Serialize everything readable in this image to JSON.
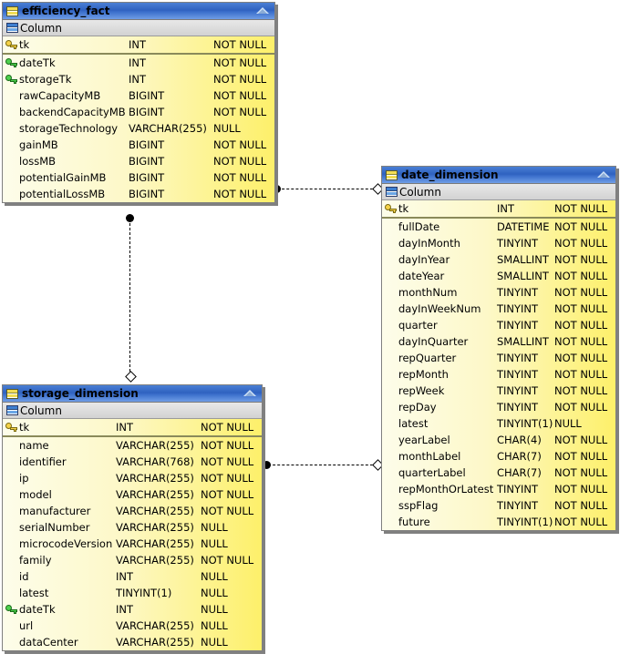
{
  "diagram": {
    "kind": "er-diagram",
    "background": "#ffffff",
    "accent_title_bar": "#3a6ecb",
    "row_fill_left": "#fdfdea",
    "row_fill_right": "#fdf06a",
    "section_label": "Column"
  },
  "entities": [
    {
      "id": "efficiency_fact",
      "title": "efficiency_fact",
      "icon": "table-icon",
      "collapse_icon": "collapse-triangle-icon",
      "section_label": "Column",
      "section_icon": "column-icon",
      "primary_keys": [
        {
          "key": "pk",
          "key_icon": "gold-key-icon",
          "name": "tk",
          "type": "INT",
          "nullable": "NOT NULL"
        }
      ],
      "columns": [
        {
          "key": "fk",
          "key_icon": "green-key-icon",
          "name": "dateTk",
          "type": "INT",
          "nullable": "NOT NULL"
        },
        {
          "key": "fk",
          "key_icon": "green-key-icon",
          "name": "storageTk",
          "type": "INT",
          "nullable": "NOT NULL"
        },
        {
          "key": "",
          "key_icon": "",
          "name": "rawCapacityMB",
          "type": "BIGINT",
          "nullable": "NOT NULL"
        },
        {
          "key": "",
          "key_icon": "",
          "name": "backendCapacityMB",
          "type": "BIGINT",
          "nullable": "NOT NULL"
        },
        {
          "key": "",
          "key_icon": "",
          "name": "storageTechnology",
          "type": "VARCHAR(255)",
          "nullable": "NULL"
        },
        {
          "key": "",
          "key_icon": "",
          "name": "gainMB",
          "type": "BIGINT",
          "nullable": "NOT NULL"
        },
        {
          "key": "",
          "key_icon": "",
          "name": "lossMB",
          "type": "BIGINT",
          "nullable": "NOT NULL"
        },
        {
          "key": "",
          "key_icon": "",
          "name": "potentialGainMB",
          "type": "BIGINT",
          "nullable": "NOT NULL"
        },
        {
          "key": "",
          "key_icon": "",
          "name": "potentialLossMB",
          "type": "BIGINT",
          "nullable": "NOT NULL"
        }
      ]
    },
    {
      "id": "date_dimension",
      "title": "date_dimension",
      "icon": "table-icon",
      "collapse_icon": "collapse-triangle-icon",
      "section_label": "Column",
      "section_icon": "column-icon",
      "primary_keys": [
        {
          "key": "pk",
          "key_icon": "gold-key-icon",
          "name": "tk",
          "type": "INT",
          "nullable": "NOT NULL"
        }
      ],
      "columns": [
        {
          "key": "",
          "key_icon": "",
          "name": "fullDate",
          "type": "DATETIME",
          "nullable": "NOT NULL"
        },
        {
          "key": "",
          "key_icon": "",
          "name": "dayInMonth",
          "type": "TINYINT",
          "nullable": "NOT NULL"
        },
        {
          "key": "",
          "key_icon": "",
          "name": "dayInYear",
          "type": "SMALLINT",
          "nullable": "NOT NULL"
        },
        {
          "key": "",
          "key_icon": "",
          "name": "dateYear",
          "type": "SMALLINT",
          "nullable": "NOT NULL"
        },
        {
          "key": "",
          "key_icon": "",
          "name": "monthNum",
          "type": "TINYINT",
          "nullable": "NOT NULL"
        },
        {
          "key": "",
          "key_icon": "",
          "name": "dayInWeekNum",
          "type": "TINYINT",
          "nullable": "NOT NULL"
        },
        {
          "key": "",
          "key_icon": "",
          "name": "quarter",
          "type": "TINYINT",
          "nullable": "NOT NULL"
        },
        {
          "key": "",
          "key_icon": "",
          "name": "dayInQuarter",
          "type": "SMALLINT",
          "nullable": "NOT NULL"
        },
        {
          "key": "",
          "key_icon": "",
          "name": "repQuarter",
          "type": "TINYINT",
          "nullable": "NOT NULL"
        },
        {
          "key": "",
          "key_icon": "",
          "name": "repMonth",
          "type": "TINYINT",
          "nullable": "NOT NULL"
        },
        {
          "key": "",
          "key_icon": "",
          "name": "repWeek",
          "type": "TINYINT",
          "nullable": "NOT NULL"
        },
        {
          "key": "",
          "key_icon": "",
          "name": "repDay",
          "type": "TINYINT",
          "nullable": "NOT NULL"
        },
        {
          "key": "",
          "key_icon": "",
          "name": "latest",
          "type": "TINYINT(1)",
          "nullable": "NULL"
        },
        {
          "key": "",
          "key_icon": "",
          "name": "yearLabel",
          "type": "CHAR(4)",
          "nullable": "NOT NULL"
        },
        {
          "key": "",
          "key_icon": "",
          "name": "monthLabel",
          "type": "CHAR(7)",
          "nullable": "NOT NULL"
        },
        {
          "key": "",
          "key_icon": "",
          "name": "quarterLabel",
          "type": "CHAR(7)",
          "nullable": "NOT NULL"
        },
        {
          "key": "",
          "key_icon": "",
          "name": "repMonthOrLatest",
          "type": "TINYINT",
          "nullable": "NOT NULL"
        },
        {
          "key": "",
          "key_icon": "",
          "name": "sspFlag",
          "type": "TINYINT",
          "nullable": "NOT NULL"
        },
        {
          "key": "",
          "key_icon": "",
          "name": "future",
          "type": "TINYINT(1)",
          "nullable": "NOT NULL"
        }
      ]
    },
    {
      "id": "storage_dimension",
      "title": "storage_dimension",
      "icon": "table-icon",
      "collapse_icon": "collapse-triangle-icon",
      "section_label": "Column",
      "section_icon": "column-icon",
      "primary_keys": [
        {
          "key": "pk",
          "key_icon": "gold-key-icon",
          "name": "tk",
          "type": "INT",
          "nullable": "NOT NULL"
        }
      ],
      "columns": [
        {
          "key": "",
          "key_icon": "",
          "name": "name",
          "type": "VARCHAR(255)",
          "nullable": "NOT NULL"
        },
        {
          "key": "",
          "key_icon": "",
          "name": "identifier",
          "type": "VARCHAR(768)",
          "nullable": "NOT NULL"
        },
        {
          "key": "",
          "key_icon": "",
          "name": "ip",
          "type": "VARCHAR(255)",
          "nullable": "NOT NULL"
        },
        {
          "key": "",
          "key_icon": "",
          "name": "model",
          "type": "VARCHAR(255)",
          "nullable": "NOT NULL"
        },
        {
          "key": "",
          "key_icon": "",
          "name": "manufacturer",
          "type": "VARCHAR(255)",
          "nullable": "NOT NULL"
        },
        {
          "key": "",
          "key_icon": "",
          "name": "serialNumber",
          "type": "VARCHAR(255)",
          "nullable": "NULL"
        },
        {
          "key": "",
          "key_icon": "",
          "name": "microcodeVersion",
          "type": "VARCHAR(255)",
          "nullable": "NULL"
        },
        {
          "key": "",
          "key_icon": "",
          "name": "family",
          "type": "VARCHAR(255)",
          "nullable": "NOT NULL"
        },
        {
          "key": "",
          "key_icon": "",
          "name": "id",
          "type": "INT",
          "nullable": "NULL"
        },
        {
          "key": "",
          "key_icon": "",
          "name": "latest",
          "type": "TINYINT(1)",
          "nullable": "NULL"
        },
        {
          "key": "fk",
          "key_icon": "green-key-icon",
          "name": "dateTk",
          "type": "INT",
          "nullable": "NULL"
        },
        {
          "key": "",
          "key_icon": "",
          "name": "url",
          "type": "VARCHAR(255)",
          "nullable": "NULL"
        },
        {
          "key": "",
          "key_icon": "",
          "name": "dataCenter",
          "type": "VARCHAR(255)",
          "nullable": "NULL"
        }
      ]
    }
  ],
  "relationships": [
    {
      "id": "rel-efficiency-date",
      "from": "efficiency_fact",
      "to": "date_dimension",
      "from_marker": "filled-circle",
      "to_marker": "hollow-diamond"
    },
    {
      "id": "rel-efficiency-storage",
      "from": "efficiency_fact",
      "to": "storage_dimension",
      "from_marker": "filled-circle",
      "to_marker": "hollow-diamond"
    },
    {
      "id": "rel-storage-date",
      "from": "storage_dimension",
      "to": "date_dimension",
      "from_marker": "filled-circle",
      "to_marker": "hollow-diamond"
    }
  ]
}
